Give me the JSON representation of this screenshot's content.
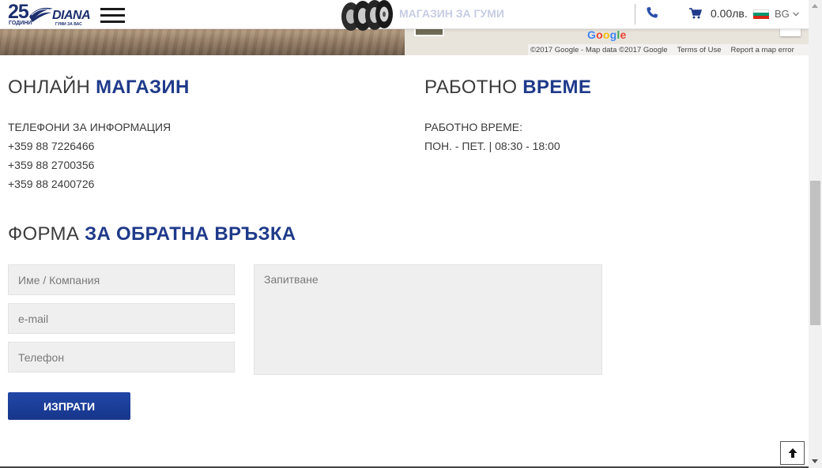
{
  "header": {
    "logo_number": "25",
    "logo_years": "ГОДИНИ",
    "logo_brand": "DIANA",
    "logo_tagline": "ГУМИ ЗА ВАС",
    "shop_link": "МАГАЗИН ЗА ГУМИ",
    "cart_total": "0.00лв.",
    "language": "BG"
  },
  "map": {
    "logo": [
      "G",
      "o",
      "o",
      "g",
      "l",
      "e"
    ],
    "attribution": "©2017 Google - Map data ©2017 Google",
    "terms": "Terms of Use",
    "report": "Report a map error"
  },
  "online_shop": {
    "title_light": "ОНЛАЙН",
    "title_bold": "МАГАЗИН",
    "phones_label": "ТЕЛЕФОНИ ЗА ИНФОРМАЦИЯ",
    "phones": [
      "+359 88 7226466",
      "+359 88 2700356",
      "+359 88 2400726"
    ]
  },
  "working_hours": {
    "title_light": "РАБОТНО",
    "title_bold": "ВРЕМЕ",
    "label": "РАБОТНО ВРЕМЕ:",
    "hours": "ПОН. - ПЕТ. | 08:30 - 18:00"
  },
  "contact_form": {
    "title_light": "ФОРМА",
    "title_bold": "ЗА ОБРАТНА ВРЪЗКА",
    "name_placeholder": "Име / Компания",
    "email_placeholder": "e-mail",
    "phone_placeholder": "Телефон",
    "message_placeholder": "Запитване",
    "submit_label": "ИЗПРАТИ"
  },
  "colors": {
    "brand_blue": "#1f3a8a",
    "button_blue": "#1f44a0",
    "field_bg": "#efefef"
  }
}
